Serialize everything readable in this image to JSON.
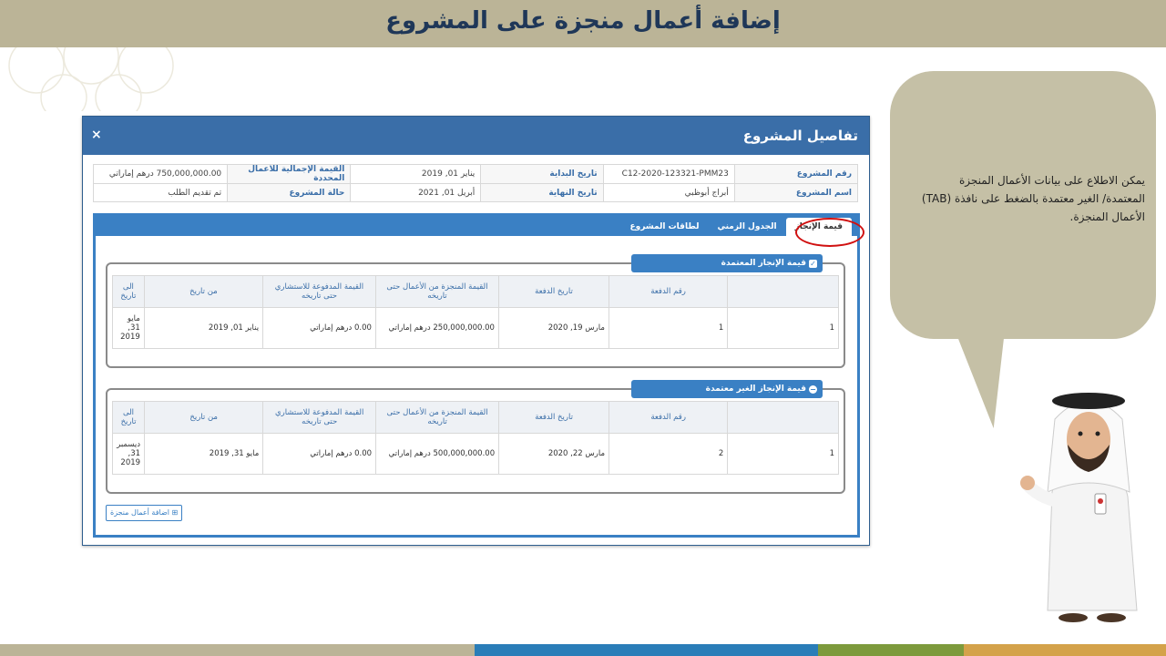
{
  "slide": {
    "title": "إضافة أعمال منجزة على المشروع",
    "explanation": "يمكن الاطلاع على بيانات الأعمال المنجزة المعتمدة/ الغير معتمدة بالضغط على نافذة (TAB) الأعمال المنجزة."
  },
  "window": {
    "title": "تفاصيل المشروع",
    "close_icon": "×"
  },
  "info": {
    "project_number_label": "رقم المشروع",
    "project_number": "C12-2020-123321-PMM23",
    "start_date_label": "تاريخ البداية",
    "start_date": "يناير 01, 2019",
    "total_value_label": "القيمة الإجمالية للاعمال المحددة",
    "total_value": "750,000,000.00 درهم إماراتي",
    "project_name_label": "اسم المشروع",
    "project_name": "أبراج أبوظبي",
    "end_date_label": "تاريخ النهاية",
    "end_date": "أبريل 01, 2021",
    "status_label": "حالة المشروع",
    "status": "تم تقديم الطلب"
  },
  "tabs": {
    "achievement_value": "قيمة الإنجاز",
    "schedule": "الجدول الزمني",
    "project_cards": "لطاقات المشروع"
  },
  "approved": {
    "title": "قيمة الإنجاز المعتمدة",
    "headers": [
      "",
      "رقم الدفعة",
      "تاريخ الدفعة",
      "القيمة المنجزة من الأعمال حتى تاريخه",
      "القيمة المدفوعة للاستشاري حتى تاريخه",
      "من تاريخ",
      "الى تاريخ"
    ],
    "row": [
      "1",
      "1",
      "مارس 19, 2020",
      "250,000,000.00 درهم إماراتي",
      "0.00 درهم إماراتي",
      "يناير 01, 2019",
      "مايو 31, 2019"
    ]
  },
  "unapproved": {
    "title": "قيمة الإنجاز الغير معتمدة",
    "headers": [
      "",
      "رقم الدفعة",
      "تاريخ الدفعة",
      "القيمة المنجزة من الأعمال حتى تاريخه",
      "القيمة المدفوعة للاستشاري حتى تاريخه",
      "من تاريخ",
      "الى تاريخ"
    ],
    "row": [
      "1",
      "2",
      "مارس 22, 2020",
      "500,000,000.00 درهم إماراتي",
      "0.00 درهم إماراتي",
      "مايو 31, 2019",
      "ديسمبر 31, 2019"
    ]
  },
  "add_button": "اضافة أعمال منجزة",
  "colors": {
    "header_bar": "#bbb497",
    "title_text": "#1f3758",
    "window_header": "#3a6ea8",
    "tab_bar": "#3a80c4",
    "highlight": "#d01010",
    "bubble": "#c5c0a6",
    "bottom_bar": [
      "#bbb497",
      "#2a7db8",
      "#7d9a3c",
      "#d4a24a"
    ]
  }
}
